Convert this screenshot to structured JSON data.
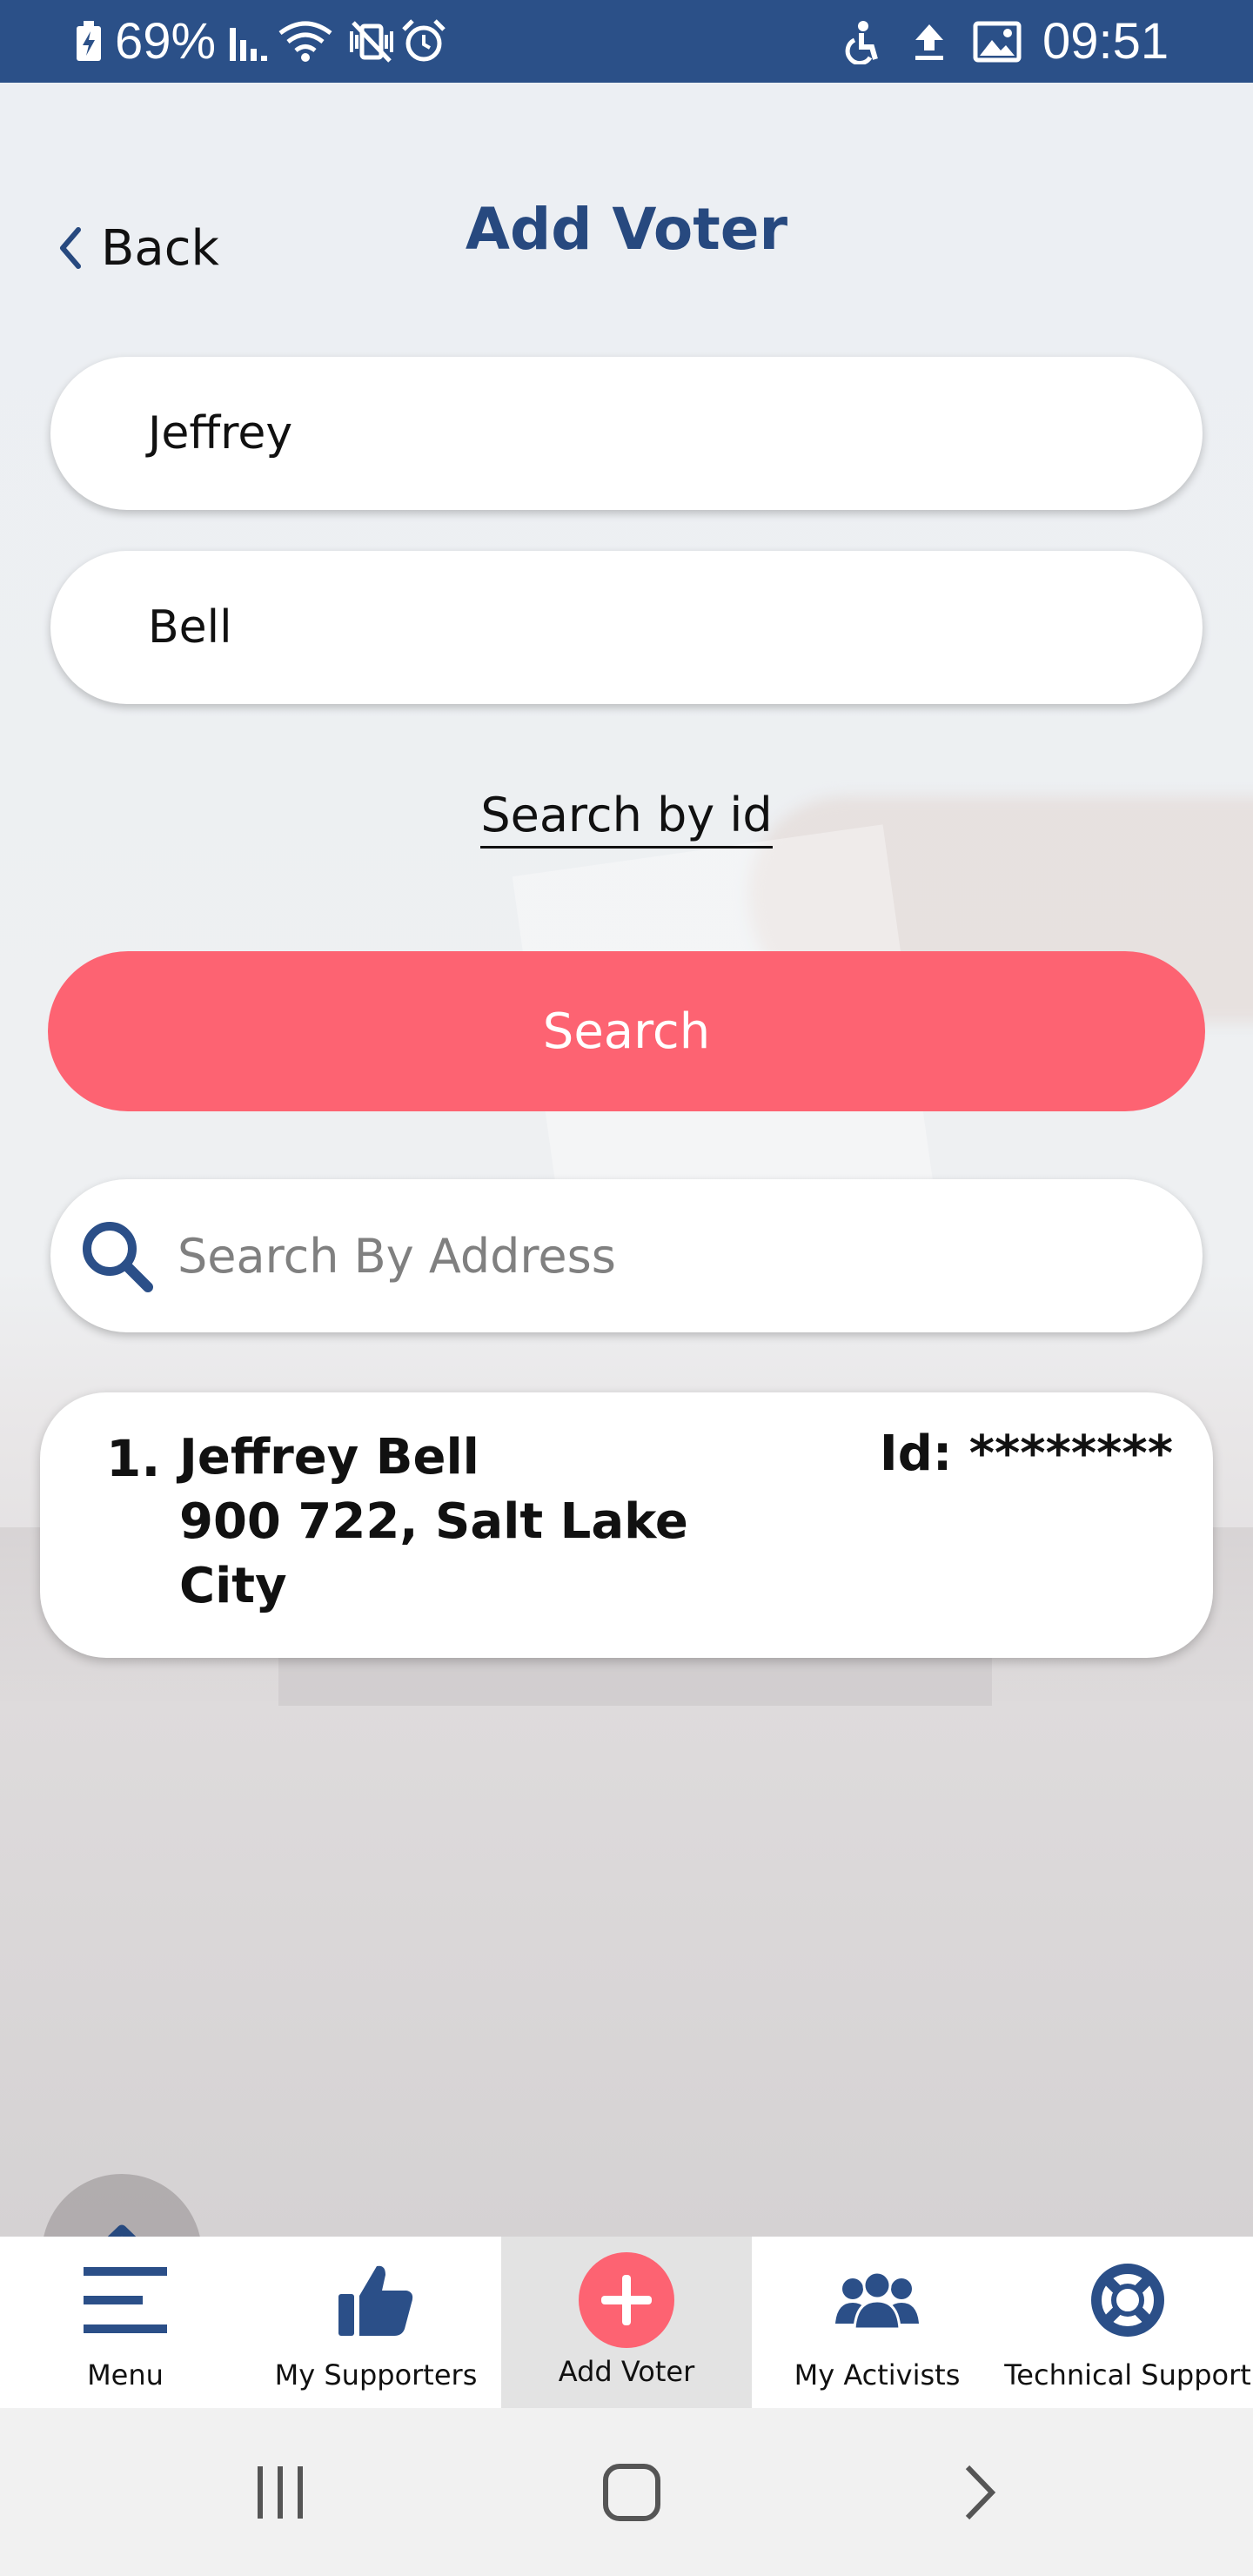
{
  "status_bar": {
    "battery": "69%",
    "time": "09:51",
    "icons": [
      "battery-charging-icon",
      "signal-icon",
      "wifi-icon",
      "vibrate-mute-icon",
      "alarm-icon",
      "accessibility-icon",
      "upload-icon",
      "image-icon"
    ]
  },
  "header": {
    "back_label": "Back",
    "title": "Add Voter"
  },
  "form": {
    "first_name_value": "Jeffrey",
    "last_name_value": "Bell",
    "search_by_id_label": "Search by id",
    "search_button_label": "Search",
    "address_placeholder": "Search By Address"
  },
  "results": [
    {
      "index": "1.",
      "name": "Jeffrey Bell",
      "address_line1": "900 722, Salt Lake",
      "address_line2": "City",
      "id_label": "Id: ********"
    }
  ],
  "tabs": [
    {
      "label": "Menu",
      "icon": "menu-icon",
      "active": false
    },
    {
      "label": "My Supporters",
      "icon": "thumbs-up-icon",
      "active": false
    },
    {
      "label": "Add Voter",
      "icon": "add-circle-icon",
      "active": true
    },
    {
      "label": "My Activists",
      "icon": "group-icon",
      "active": false
    },
    {
      "label": "Technical Support",
      "icon": "lifebuoy-icon",
      "active": false
    }
  ],
  "colors": {
    "status_bar": "#2b5088",
    "title": "#27497f",
    "accent": "#fd6372",
    "icon_blue": "#2b4f88"
  }
}
